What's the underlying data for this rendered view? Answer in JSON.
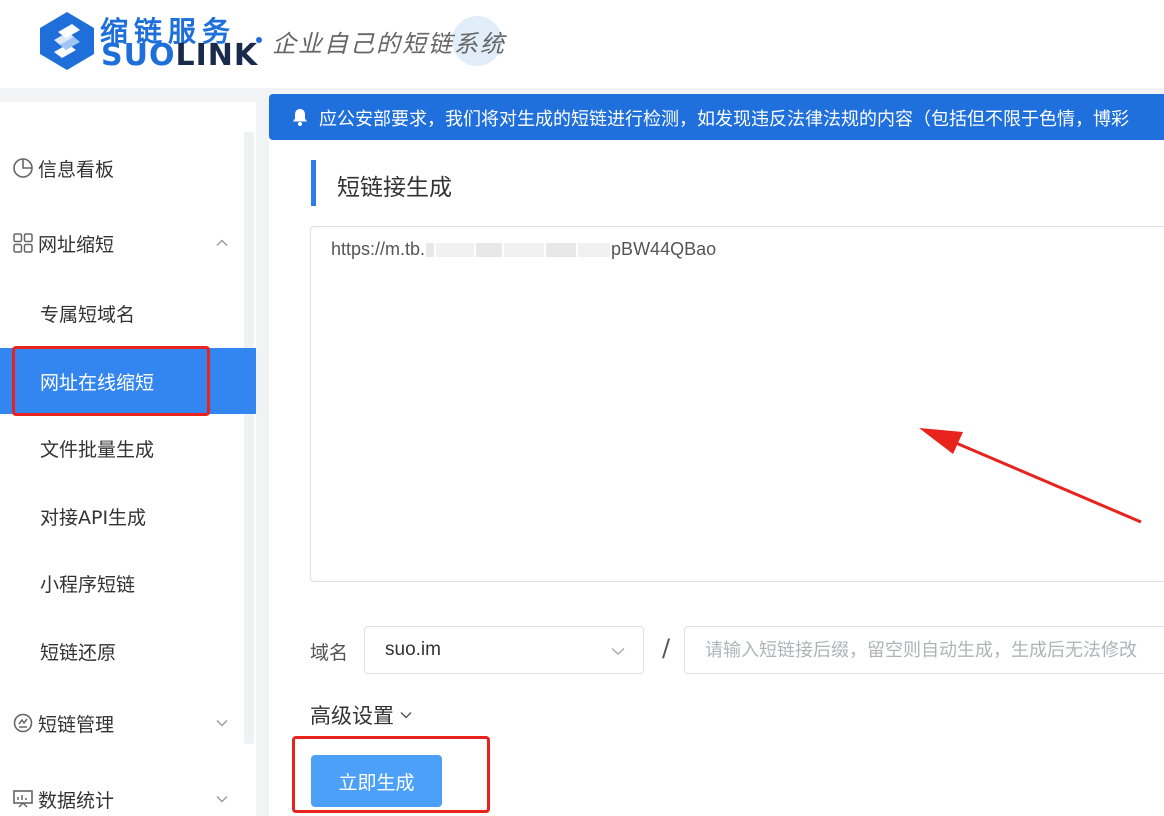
{
  "header": {
    "brand_cn": "缩链服务",
    "brand_en_prefix": "SUO",
    "brand_en_suffix": "LINK",
    "tagline": "企业自己的短链系统"
  },
  "sidebar": {
    "groups": [
      {
        "label": "信息看板",
        "icon": "pie-chart-icon",
        "has_chevron": false
      },
      {
        "label": "网址缩短",
        "icon": "grid-icon",
        "expanded": true
      },
      {
        "label": "短链管理",
        "icon": "gear-icon",
        "expanded": false
      },
      {
        "label": "数据统计",
        "icon": "monitor-icon",
        "expanded": false
      }
    ],
    "sub_items": [
      {
        "label": "专属短域名",
        "active": false
      },
      {
        "label": "网址在线缩短",
        "active": true
      },
      {
        "label": "文件批量生成",
        "active": false
      },
      {
        "label": "对接API生成",
        "active": false
      },
      {
        "label": "小程序短链",
        "active": false
      },
      {
        "label": "短链还原",
        "active": false
      }
    ]
  },
  "notice": {
    "text": "应公安部要求，我们将对生成的短链进行检测，如发现违反法律法规的内容（包括但不限于色情，博彩"
  },
  "main": {
    "section_title": "短链接生成",
    "url_value_start": "https://m.tb.",
    "url_value_end": "pBW44QBao",
    "domain_label": "域名",
    "domain_value": "suo.im",
    "slash": "/",
    "suffix_placeholder": "请输入短链接后缀，留空则自动生成，生成后无法修改",
    "advanced_label": "高级设置",
    "generate_label": "立即生成"
  },
  "colors": {
    "brand_blue": "#1e6fd9",
    "notice_bg": "#1f6fdc",
    "active_menu_bg": "#3385f0",
    "button_bg": "#4da0f7",
    "annotation_red": "#e8231e"
  }
}
